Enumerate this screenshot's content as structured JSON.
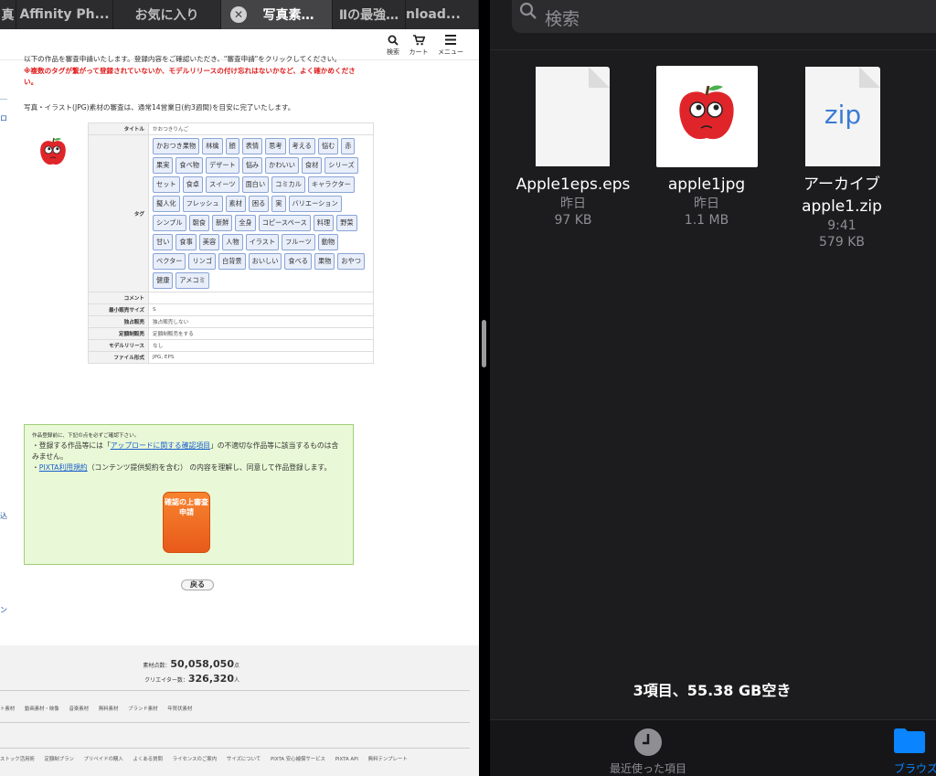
{
  "browser": {
    "tabs": [
      {
        "label": "真"
      },
      {
        "label": "Affinity Ph..."
      },
      {
        "label": "お気に入り"
      },
      {
        "label": "写真素…"
      },
      {
        "label": "Ⅱの最強…"
      },
      {
        "label": "nload..."
      }
    ]
  },
  "site_nav": {
    "search": "検索",
    "cart": "カート",
    "menu": "メニュー"
  },
  "page": {
    "notice": "以下の作品を審査申請いたします。登録内容をご確認いただき、\"審査申請\"をクリックしてください。",
    "warning": "※複数のタグが繋がって登録されていないか、モデルリリースの付け忘れはないかなど、よく確かめください。",
    "review_time": "写真・イラスト(JPG)素材の審査は、通常14営業日(約3週間)を目安に完了いたします。",
    "left_marks": [
      "＿",
      "ロ",
      "込",
      "ン"
    ],
    "labels": {
      "title": "タイトル",
      "tags": "タグ",
      "comment": "コメント",
      "min_size": "最小販売サイズ",
      "exclusive": "独占販売",
      "fixed_price": "定額制販売",
      "model_release": "モデルリリース",
      "file_format": "ファイル形式"
    },
    "values": {
      "title": "かおつきりんご",
      "comment": "",
      "min_size": "S",
      "exclusive": "独占販売しない",
      "fixed_price": "定額制販売をする",
      "model_release": "なし",
      "file_format": "JPG, EPS"
    },
    "tags": [
      "かおつき果物",
      "林檎",
      "顔",
      "表情",
      "思考",
      "考える",
      "悩む",
      "赤",
      "果実",
      "食べ物",
      "デザート",
      "悩み",
      "かわいい",
      "食材",
      "シリーズ",
      "セット",
      "食卓",
      "スイーツ",
      "面白い",
      "コミカル",
      "キャラクター",
      "擬人化",
      "フレッシュ",
      "素材",
      "困る",
      "実",
      "バリエーション",
      "シンプル",
      "朝食",
      "新鮮",
      "全身",
      "コピースペース",
      "料理",
      "野菜",
      "甘い",
      "食事",
      "美容",
      "人物",
      "イラスト",
      "フルーツ",
      "動物",
      "ベクター",
      "リンゴ",
      "白背景",
      "おいしい",
      "食べる",
      "果物",
      "おやつ",
      "健康",
      "アメコミ"
    ],
    "confirm": {
      "small": "作品登録前に、下記の点を必ずご確認下さい。",
      "line1_pre": "・登録する作品等には「",
      "line1_link": "アップロードに関する確認項目",
      "line1_post": "」の不適切な作品等に該当するものは含みません。",
      "line2_link": "PIXTA利用規約",
      "line2_post": "（コンテンツ提供契約を含む） の内容を理解し、同意して作品登録します。",
      "submit": "確認の上審査申請"
    },
    "back": "戻る"
  },
  "footer": {
    "assets_label": "素材点数：",
    "assets_count": "50,058,050",
    "assets_unit": "点",
    "creators_label": "クリエイター数：",
    "creators_count": "326,320",
    "creators_unit": "人",
    "links1": "ト素材　　動画素材・映像　　音楽素材　　無料素材　　ブランド素材　　年賀状素材",
    "links2": "ストック活用術　　定額制プラン　　プリペイドの購入　　よくある質問　　ライセンスのご案内　　サイズについて　　PIXTA 安心補償サービス　　PIXTA API　　無料テンプレート"
  },
  "files_app": {
    "search_placeholder": "検索",
    "files": [
      {
        "name": "Apple1eps.eps",
        "date": "昨日",
        "size": "97 KB",
        "kind": "document"
      },
      {
        "name": "apple1jpg",
        "date": "昨日",
        "size": "1.1 MB",
        "kind": "image"
      },
      {
        "name_line1": "アーカイブ",
        "name_line2": "apple1.zip",
        "date": "9:41",
        "size": "579 KB",
        "kind": "zip",
        "icon_text": "zip"
      }
    ],
    "storage": "3項目、55.38 GB空き",
    "tabs": {
      "recent": "最近使った項目",
      "browse": "ブラウズ"
    },
    "accent": "#0a84ff"
  }
}
